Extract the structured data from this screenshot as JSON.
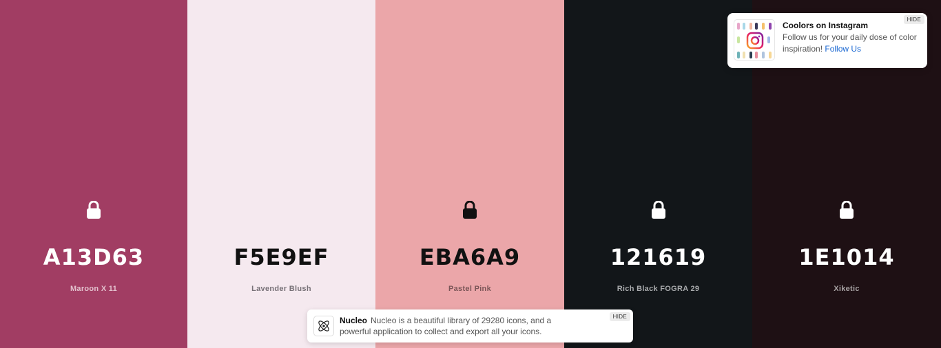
{
  "palette": {
    "colors": [
      {
        "hex": "A13D63",
        "name": "Maroon X 11",
        "bg": "#A13D63",
        "hex_color": "#ffffff",
        "name_color": "#e3c0cd",
        "icon": "lock-icon"
      },
      {
        "hex": "F5E9EF",
        "name": "Lavender Blush",
        "bg": "#F5E9EF",
        "hex_color": "#111111",
        "name_color": "#777177",
        "icon": "lock-icon"
      },
      {
        "hex": "EBA6A9",
        "name": "Pastel Pink",
        "bg": "#EBA6A9",
        "hex_color": "#111111",
        "name_color": "#7a5557",
        "icon": "lock-icon"
      },
      {
        "hex": "121619",
        "name": "Rich Black FOGRA 29",
        "bg": "#121619",
        "hex_color": "#ffffff",
        "name_color": "#a9abad",
        "icon": "lock-icon"
      },
      {
        "hex": "1E1014",
        "name": "Xiketic",
        "bg": "#1E1014",
        "hex_color": "#ffffff",
        "name_color": "#a8a3a4",
        "icon": "lock-icon"
      }
    ]
  },
  "instagram_popup": {
    "title": "Coolors on Instagram",
    "text": "Follow us for your daily dose of color inspiration!",
    "link": "Follow Us",
    "hide": "HIDE",
    "icon": "instagram-icon"
  },
  "ad_banner": {
    "title": "Nucleo",
    "text": "Nucleo is a beautiful library of 29280 icons, and a powerful application to collect and export all your icons.",
    "hide": "HIDE",
    "icon": "atom-icon"
  }
}
